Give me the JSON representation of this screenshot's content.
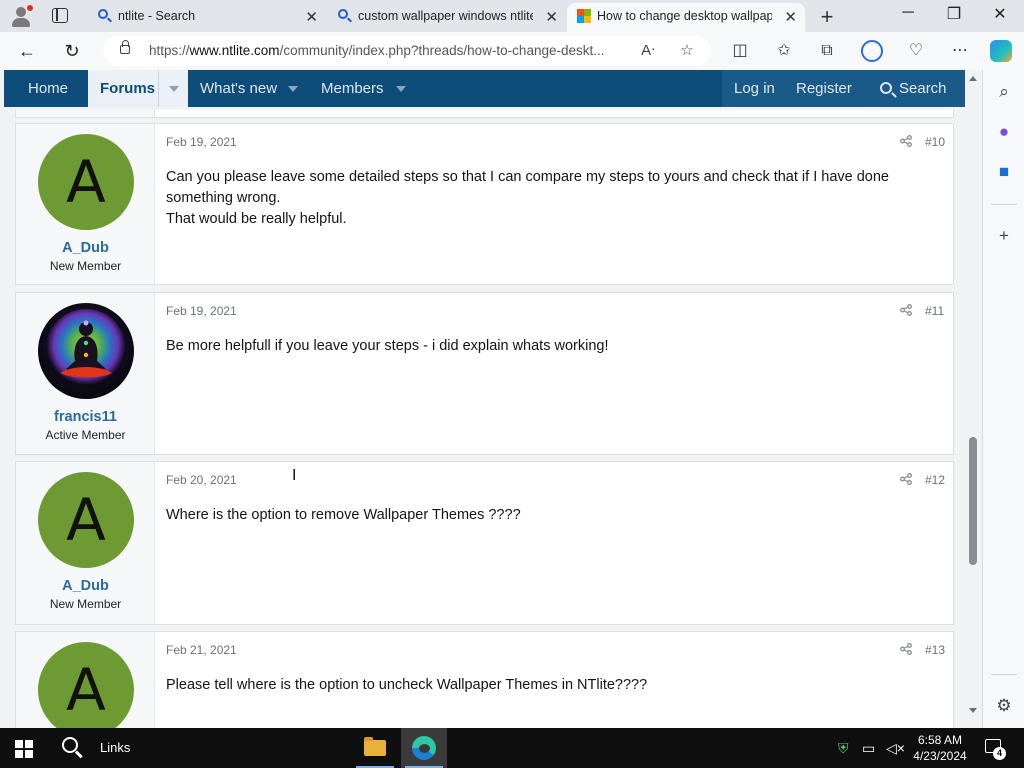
{
  "browser": {
    "tabs": [
      {
        "title": "ntlite - Search",
        "icon": "search-icon"
      },
      {
        "title": "custom wallpaper windows ntlite",
        "icon": "search-icon"
      },
      {
        "title": "How to change desktop wallpaper",
        "icon": "ms-logo-icon"
      }
    ],
    "url_prefix": "https://",
    "url_domain": "www.ntlite.com",
    "url_path": "/community/index.php?threads/how-to-change-deskt..."
  },
  "forum_nav": {
    "home": "Home",
    "forums": "Forums",
    "whats_new": "What's new",
    "members": "Members",
    "login": "Log in",
    "register": "Register",
    "search": "Search"
  },
  "posts": [
    {
      "avatar_letter": "A",
      "username": "A_Dub",
      "user_title": "New Member",
      "date": "Feb 19, 2021",
      "number": "#10",
      "lines": [
        "Can you please leave some detailed steps so that I can compare my steps to yours and check that if I have done",
        "something wrong.",
        "That would be really helpful."
      ]
    },
    {
      "avatar_letter": "",
      "username": "francis11",
      "user_title": "Active Member",
      "date": "Feb 19, 2021",
      "number": "#11",
      "lines": [
        "Be more helpfull if you leave your steps - i did explain whats working!"
      ]
    },
    {
      "avatar_letter": "A",
      "username": "A_Dub",
      "user_title": "New Member",
      "date": "Feb 20, 2021",
      "number": "#12",
      "lines": [
        "Where is the option to remove Wallpaper Themes ????"
      ]
    },
    {
      "avatar_letter": "A",
      "username": "",
      "user_title": "",
      "date": "Feb 21, 2021",
      "number": "#13",
      "lines": [
        "Please tell where is the option to uncheck Wallpaper Themes in NTlite????"
      ]
    }
  ],
  "taskbar": {
    "links_label": "Links",
    "time": "6:58 AM",
    "date": "4/23/2024",
    "notification_count": "4"
  },
  "colors": {
    "nav_bg": "#0e4c7a",
    "avatar_green": "#6e9a33",
    "username_blue": "#2a6c9e"
  }
}
